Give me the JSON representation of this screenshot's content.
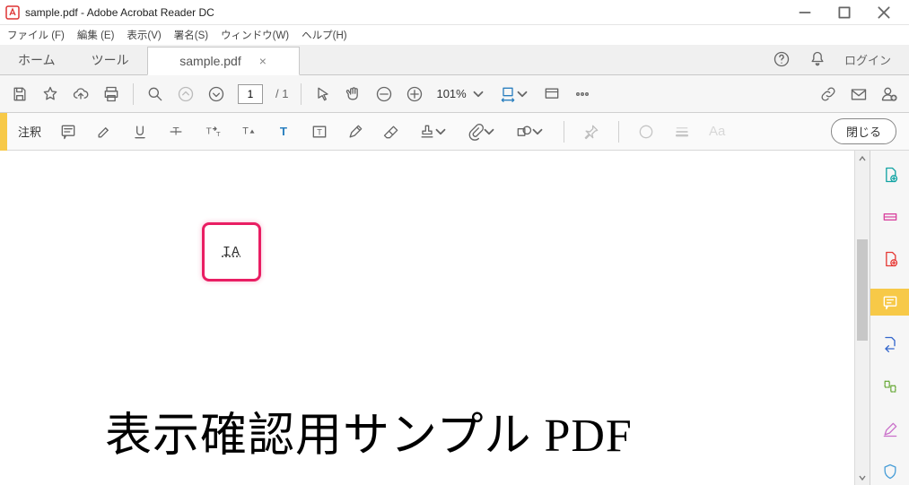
{
  "window": {
    "title": "sample.pdf - Adobe Acrobat Reader DC"
  },
  "menu": {
    "file": "ファイル (F)",
    "edit": "編集 (E)",
    "view": "表示(V)",
    "sign": "署名(S)",
    "window": "ウィンドウ(W)",
    "help": "ヘルプ(H)"
  },
  "tabs": {
    "home": "ホーム",
    "tools": "ツール",
    "doc": "sample.pdf",
    "login": "ログイン"
  },
  "toolbar": {
    "pageCurrent": "1",
    "pageTotal": "/ 1",
    "zoom": "101%"
  },
  "comment": {
    "label": "注釈",
    "close": "閉じる"
  },
  "doc": {
    "cursor": "IA",
    "heading": "表示確認用サンプル PDF"
  }
}
